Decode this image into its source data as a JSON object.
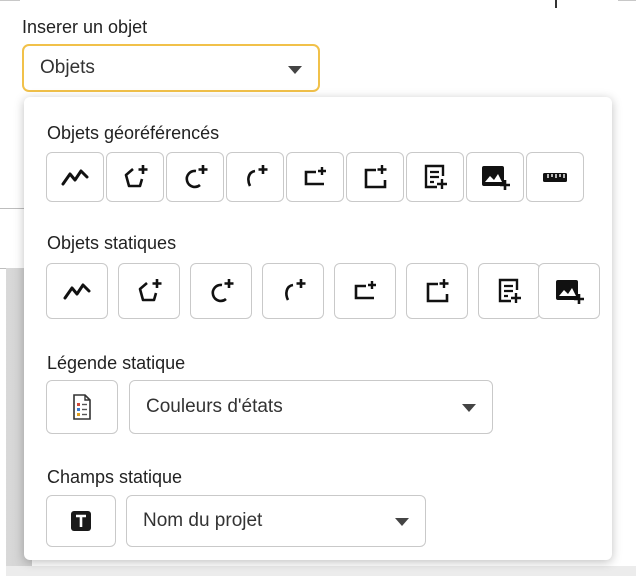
{
  "insert_object": {
    "label": "Inserer un objet",
    "select_value": "Objets"
  },
  "panel": {
    "georef": {
      "title": "Objets géoréférencés",
      "buttons": [
        "polyline-icon",
        "polygon-add-icon",
        "arc-add-icon",
        "circle-add-icon",
        "rect-small-add-icon",
        "rect-add-icon",
        "text-add-icon",
        "image-add-icon",
        "ruler-icon"
      ]
    },
    "static": {
      "title": "Objets statiques",
      "buttons": [
        "polyline-icon",
        "polygon-add-icon",
        "arc-add-icon",
        "circle-add-icon",
        "rect-small-add-icon",
        "rect-add-icon",
        "text-add-icon",
        "image-add-icon"
      ]
    },
    "legend": {
      "title": "Légende statique",
      "select_value": "Couleurs d'états"
    },
    "fields": {
      "title": "Champs statique",
      "select_value": "Nom du projet"
    }
  }
}
